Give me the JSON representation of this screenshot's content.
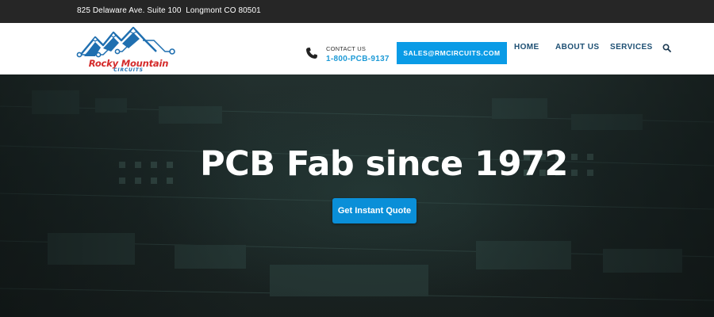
{
  "topbar": {
    "address": "825 Delaware Ave. Suite 100  Longmont CO 80501"
  },
  "logo": {
    "brand": "Rocky Mountain",
    "sub": "CIRCUITS",
    "colors": {
      "primary": "#1f6fb0",
      "accent": "#d42a2a"
    }
  },
  "contact": {
    "label": "CONTACT US",
    "phone": "1-800-PCB-9137",
    "icon": "phone-icon"
  },
  "email_button": {
    "label": "SALES@RMCIRCUITS.COM",
    "color": "#0a9be6"
  },
  "nav": {
    "items": [
      {
        "label": "HOME"
      },
      {
        "label": "ABOUT US"
      },
      {
        "label": "SERVICES"
      }
    ],
    "search_icon": "search-icon"
  },
  "hero": {
    "title": "PCB Fab since 1972",
    "cta_label": "Get Instant Quote",
    "cta_color": "#0a8fd8"
  }
}
